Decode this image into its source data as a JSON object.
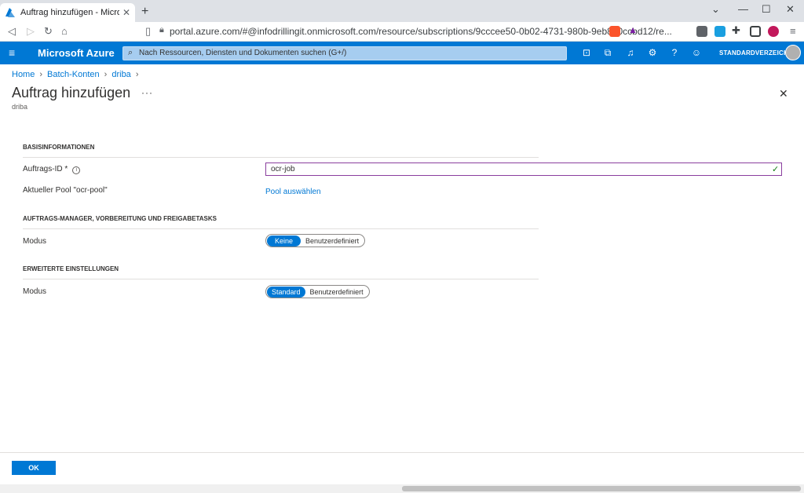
{
  "browser": {
    "tab_title": "Auftrag hinzufügen - Microsoft Azure",
    "tab_close": "✕",
    "new_tab": "+",
    "url": "portal.azure.com/#@infodrillingit.onmicrosoft.com/resource/subscriptions/9cccee50-0b02-4731-980b-9eb8e0ccbd12/re..."
  },
  "azure": {
    "brand": "Microsoft Azure",
    "search_placeholder": "Nach Ressourcen, Diensten und Dokumenten suchen (G+/)",
    "directory": "STANDARDVERZEICHNIS"
  },
  "breadcrumb": [
    "Home",
    "Batch-Konten",
    "driba"
  ],
  "page": {
    "title": "Auftrag hinzufügen",
    "more": "···",
    "subtitle": "driba"
  },
  "sections": {
    "basic": "BASISINFORMATIONEN",
    "manager": "AUFTRAGS-MANAGER, VORBEREITUNG UND FREIGABETASKS",
    "advanced": "ERWEITERTE EINSTELLUNGEN"
  },
  "fields": {
    "job_id_label": "Auftrags-ID *",
    "job_id_value": "ocr-job",
    "pool_label": "Aktueller Pool \"ocr-pool\"",
    "pool_link": "Pool auswählen",
    "mode_label_1": "Modus",
    "mode_1_options": [
      "Keine",
      "Benutzerdefiniert"
    ],
    "mode_label_2": "Modus",
    "mode_2_options": [
      "Standard",
      "Benutzerdefiniert"
    ]
  },
  "footer": {
    "ok": "OK"
  }
}
